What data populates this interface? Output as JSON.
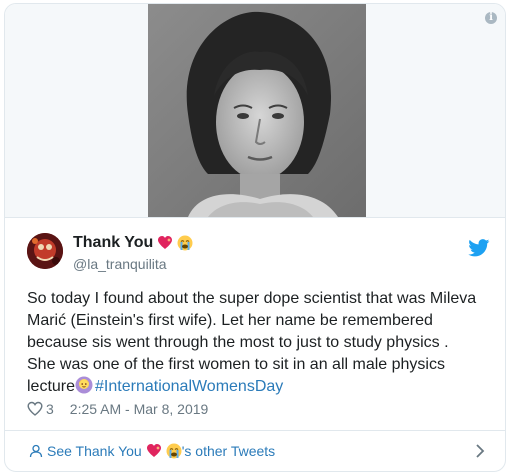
{
  "tweet": {
    "display_name": "Thank You",
    "handle": "@la_tranquilita",
    "text_lines": [
      "So today I found about the super dope scientist that was Mileva",
      "Marić (Einstein's first wife). Let her name be remembered",
      "because sis went through the most to just to study physics .",
      "She was one of the first women to sit in an all male physics"
    ],
    "last_line_text": "lecture",
    "hashtag": "#InternationalWomensDay",
    "like_count": "3",
    "timestamp": "2:25 AM - Mar 8, 2019"
  },
  "footer": {
    "link_prefix": "See Thank You",
    "link_suffix": "'s other Tweets"
  },
  "icons": {
    "info": "info-icon",
    "twitter_bird": "twitter-bird-icon",
    "heart": "heart-outline-icon",
    "user": "user-icon",
    "chevron": "chevron-right-icon"
  },
  "colors": {
    "link": "#2b7bb9",
    "muted": "#697882",
    "text": "#1c2022",
    "border": "#e1e8ed",
    "twitter_blue": "#1da1f2"
  }
}
